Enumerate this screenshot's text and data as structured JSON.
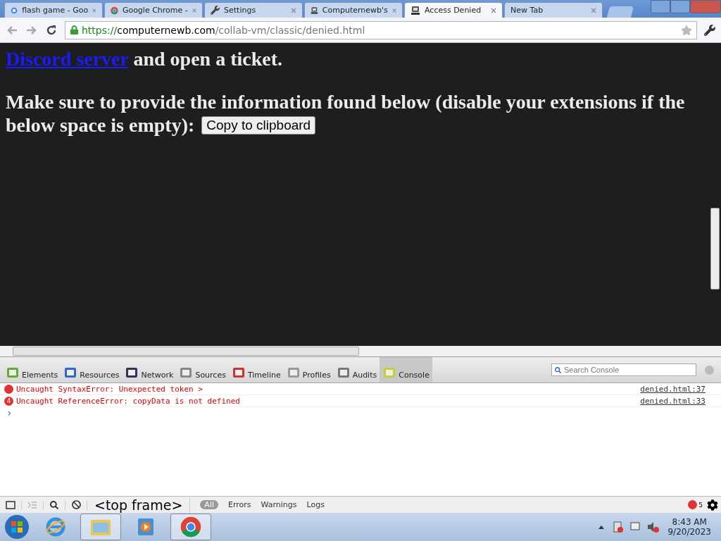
{
  "tabs": [
    {
      "label": "flash game - Goo",
      "selected": false
    },
    {
      "label": "Google Chrome -",
      "selected": false
    },
    {
      "label": "Settings",
      "selected": false
    },
    {
      "label": "Computernewb's",
      "selected": false
    },
    {
      "label": "Access Denied",
      "selected": true
    },
    {
      "label": "New Tab",
      "selected": false
    }
  ],
  "address": {
    "scheme": "https://",
    "host": "computernewb.com",
    "path": "/collab-vm/classic/denied.html"
  },
  "page": {
    "link": "Discord server",
    "link_tail": " and open a ticket.",
    "paragraph_lines": [
      "Make sure to provide the information found below (disable your extensions if the",
      "below space is empty):"
    ],
    "button": "Copy to clipboard"
  },
  "devtools": {
    "panels": [
      {
        "label": "Elements",
        "selected": false
      },
      {
        "label": "Resources",
        "selected": false
      },
      {
        "label": "Network",
        "selected": false
      },
      {
        "label": "Sources",
        "selected": false
      },
      {
        "label": "Timeline",
        "selected": false
      },
      {
        "label": "Profiles",
        "selected": false
      },
      {
        "label": "Audits",
        "selected": false
      },
      {
        "label": "Console",
        "selected": true
      }
    ],
    "search_placeholder": "Search Console",
    "messages": [
      {
        "text": "Uncaught SyntaxError: Unexpected token >",
        "source": "denied.html:37"
      },
      {
        "text": "Uncaught ReferenceError: copyData is not defined",
        "count": "4",
        "source": "denied.html:33"
      }
    ],
    "prompt": "›",
    "frame": "<top frame>",
    "filters": [
      {
        "label": "All",
        "selected": true
      },
      {
        "label": "Errors",
        "selected": false
      },
      {
        "label": "Warnings",
        "selected": false
      },
      {
        "label": "Logs",
        "selected": false
      }
    ],
    "error_count": "5"
  },
  "taskbar": {
    "apps": [
      {
        "kind": "ie",
        "selected": false
      },
      {
        "kind": "explorer",
        "selected": true
      },
      {
        "kind": "media",
        "selected": false
      },
      {
        "kind": "chrome",
        "selected": true
      }
    ],
    "time": "8:43 AM",
    "date": "9/20/2023"
  }
}
